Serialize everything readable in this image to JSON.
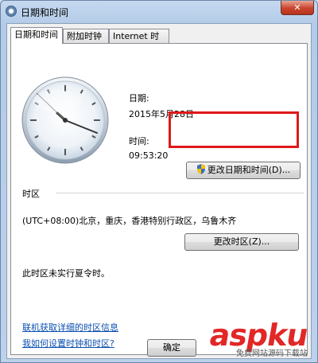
{
  "window": {
    "title": "日期和时间",
    "close_label": "✕"
  },
  "tabs": [
    {
      "label": "日期和时间",
      "active": true
    },
    {
      "label": "附加时钟",
      "active": false
    },
    {
      "label": "Internet 时间",
      "active": false
    }
  ],
  "date_section": {
    "date_label": "日期:",
    "date_value": "2015年5月28日",
    "time_label": "时间:",
    "time_value": "09:53:20",
    "change_datetime_button": "更改日期和时间(D)..."
  },
  "timezone_section": {
    "heading": "时区",
    "timezone_value": "(UTC+08:00)北京，重庆，香港特别行政区，乌鲁木齐",
    "change_timezone_button": "更改时区(Z)...",
    "dst_note": "此时区未实行夏令时。"
  },
  "links": {
    "online_info": "联机获取详细的时区信息",
    "how_to_set": "我如何设置时钟和时区?"
  },
  "footer": {
    "ok_button": "确定"
  },
  "watermark": {
    "brand": "aspku",
    "sub": "免费网站源码下载站"
  },
  "colors": {
    "highlight_border": "#e01818",
    "link": "#0b4fb0",
    "watermark": "#e11c1c"
  }
}
